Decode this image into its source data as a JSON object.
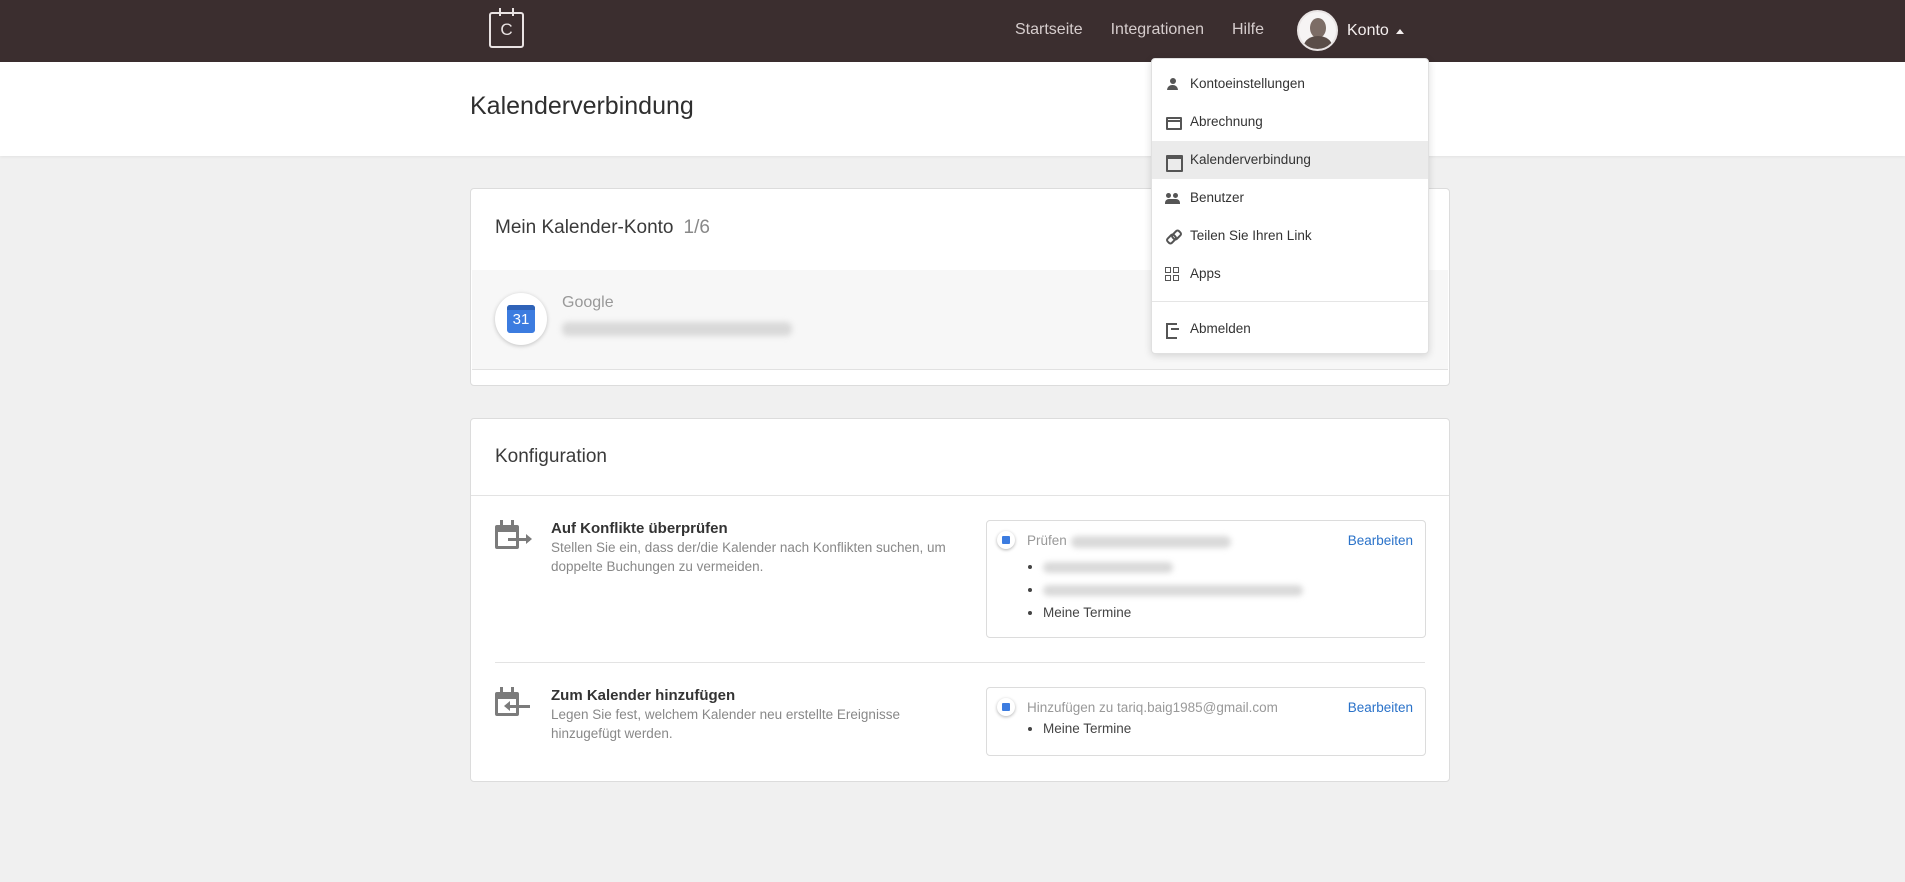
{
  "nav": {
    "logo_letter": "C",
    "links": [
      "Startseite",
      "Integrationen",
      "Hilfe"
    ],
    "account_label": "Konto"
  },
  "page": {
    "title": "Kalenderverbindung"
  },
  "calendar_account": {
    "title": "Mein Kalender-Konto",
    "counter": "1/6",
    "provider": "Google",
    "provider_badge": "31"
  },
  "configuration": {
    "title": "Konfiguration",
    "conflicts": {
      "title": "Auf Konflikte überprüfen",
      "description": "Stellen Sie ein, dass der/die Kalender nach Konflikten suchen, um doppelte Buchungen zu vermeiden.",
      "box_label": "Prüfen",
      "edit_label": "Bearbeiten",
      "visible_calendar": "Meine Termine"
    },
    "add_to_calendar": {
      "title": "Zum Kalender hinzufügen",
      "description": "Legen Sie fest, welchem Kalender neu erstellte Ereignisse hinzugefügt werden.",
      "box_label": "Hinzufügen zu tariq.baig1985@gmail.com",
      "edit_label": "Bearbeiten",
      "visible_calendar": "Meine Termine"
    }
  },
  "account_menu": {
    "items": [
      {
        "label": "Kontoeinstellungen",
        "icon": "user-icon"
      },
      {
        "label": "Abrechnung",
        "icon": "credit-card-icon"
      },
      {
        "label": "Kalenderverbindung",
        "icon": "calendar-icon",
        "active": true
      },
      {
        "label": "Benutzer",
        "icon": "users-icon"
      },
      {
        "label": "Teilen Sie Ihren Link",
        "icon": "link-icon"
      },
      {
        "label": "Apps",
        "icon": "apps-icon"
      }
    ],
    "logout_label": "Abmelden"
  },
  "colors": {
    "topbar": "#3b2e2f",
    "link": "#2a72c9",
    "google_blue": "#3c7ce0"
  }
}
